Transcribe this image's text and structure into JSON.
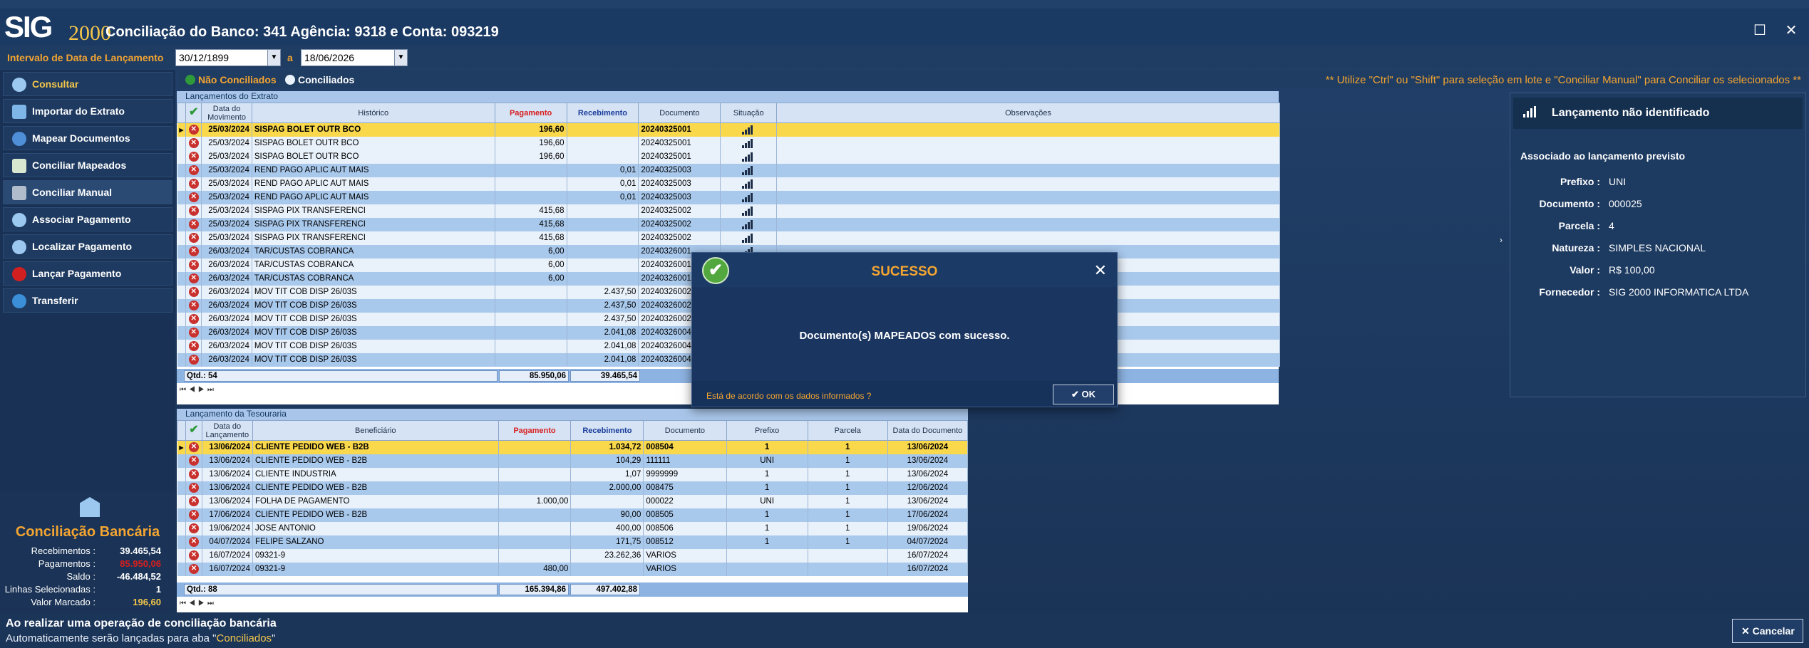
{
  "app": {
    "logo_main": "SIG",
    "logo_sub": "2000",
    "title": "Conciliação do Banco: 341 Agência: 9318 e Conta: 093219"
  },
  "filter": {
    "label": "Intervalo de Data de Lançamento",
    "from": "30/12/1899",
    "sep": "a",
    "to": "18/06/2026"
  },
  "sidebar": {
    "items": [
      {
        "label": "Consultar",
        "icon": "magnifier-icon"
      },
      {
        "label": "Importar do Extrato",
        "icon": "import-icon"
      },
      {
        "label": "Mapear Documentos",
        "icon": "map-pin-icon"
      },
      {
        "label": "Conciliar Mapeados",
        "icon": "checklist-icon"
      },
      {
        "label": "Conciliar Manual",
        "icon": "manual-icon"
      },
      {
        "label": "Associar Pagamento",
        "icon": "magnifier-icon"
      },
      {
        "label": "Localizar Pagamento",
        "icon": "magnifier-icon"
      },
      {
        "label": "Lançar Pagamento",
        "icon": "red-dot-icon"
      },
      {
        "label": "Transferir",
        "icon": "share-icon"
      }
    ]
  },
  "summary": {
    "title": "Conciliação Bancária",
    "rows": [
      {
        "label": "Recebimentos :",
        "value": "39.465,54",
        "color": "#ffffff"
      },
      {
        "label": "Pagamentos :",
        "value": "85.950,06",
        "color": "#d81f1f"
      },
      {
        "label": "Saldo :",
        "value": "-46.484,52",
        "color": "#ffffff"
      },
      {
        "label": "Linhas Selecionadas :",
        "value": "1",
        "color": "#ffffff"
      },
      {
        "label": "Valor Marcado :",
        "value": "196,60",
        "color": "#f4c64a"
      }
    ]
  },
  "legend": {
    "not_reconciled": "Não Conciliados",
    "reconciled": "Conciliados",
    "hint": "** Utilize \"Ctrl\" ou \"Shift\" para seleção em lote e \"Conciliar Manual\" para Conciliar os selecionados **"
  },
  "extrato": {
    "title": "Lançamentos do Extrato",
    "headers": [
      "Data do Movimento",
      "Histórico",
      "Pagamento",
      "Recebimento",
      "Documento",
      "Situação",
      "Observações"
    ],
    "rows": [
      {
        "date": "25/03/2024",
        "hist": "SISPAG BOLET OUTR BCO",
        "pay": "196,60",
        "rec": "",
        "doc": "20240325001",
        "style": "sel"
      },
      {
        "date": "25/03/2024",
        "hist": "SISPAG BOLET OUTR BCO",
        "pay": "196,60",
        "rec": "",
        "doc": "20240325001",
        "style": "even"
      },
      {
        "date": "25/03/2024",
        "hist": "SISPAG BOLET OUTR BCO",
        "pay": "196,60",
        "rec": "",
        "doc": "20240325001",
        "style": "even"
      },
      {
        "date": "25/03/2024",
        "hist": "REND PAGO APLIC AUT MAIS",
        "pay": "",
        "rec": "0,01",
        "doc": "20240325003",
        "style": "alt"
      },
      {
        "date": "25/03/2024",
        "hist": "REND PAGO APLIC AUT MAIS",
        "pay": "",
        "rec": "0,01",
        "doc": "20240325003",
        "style": "even"
      },
      {
        "date": "25/03/2024",
        "hist": "REND PAGO APLIC AUT MAIS",
        "pay": "",
        "rec": "0,01",
        "doc": "20240325003",
        "style": "alt"
      },
      {
        "date": "25/03/2024",
        "hist": "SISPAG PIX TRANSFERENCI",
        "pay": "415,68",
        "rec": "",
        "doc": "20240325002",
        "style": "even"
      },
      {
        "date": "25/03/2024",
        "hist": "SISPAG PIX TRANSFERENCI",
        "pay": "415,68",
        "rec": "",
        "doc": "20240325002",
        "style": "alt"
      },
      {
        "date": "25/03/2024",
        "hist": "SISPAG PIX TRANSFERENCI",
        "pay": "415,68",
        "rec": "",
        "doc": "20240325002",
        "style": "even"
      },
      {
        "date": "26/03/2024",
        "hist": "TAR/CUSTAS COBRANCA",
        "pay": "6,00",
        "rec": "",
        "doc": "20240326001",
        "style": "alt"
      },
      {
        "date": "26/03/2024",
        "hist": "TAR/CUSTAS COBRANCA",
        "pay": "6,00",
        "rec": "",
        "doc": "20240326001",
        "style": "even"
      },
      {
        "date": "26/03/2024",
        "hist": "TAR/CUSTAS COBRANCA",
        "pay": "6,00",
        "rec": "",
        "doc": "20240326001",
        "style": "alt"
      },
      {
        "date": "26/03/2024",
        "hist": "MOV TIT COB DISP 26/03S",
        "pay": "",
        "rec": "2.437,50",
        "doc": "20240326002",
        "style": "even"
      },
      {
        "date": "26/03/2024",
        "hist": "MOV TIT COB DISP 26/03S",
        "pay": "",
        "rec": "2.437,50",
        "doc": "20240326002",
        "style": "alt"
      },
      {
        "date": "26/03/2024",
        "hist": "MOV TIT COB DISP 26/03S",
        "pay": "",
        "rec": "2.437,50",
        "doc": "20240326002",
        "style": "even"
      },
      {
        "date": "26/03/2024",
        "hist": "MOV TIT COB DISP 26/03S",
        "pay": "",
        "rec": "2.041,08",
        "doc": "20240326004",
        "style": "alt"
      },
      {
        "date": "26/03/2024",
        "hist": "MOV TIT COB DISP 26/03S",
        "pay": "",
        "rec": "2.041,08",
        "doc": "20240326004",
        "style": "even"
      },
      {
        "date": "26/03/2024",
        "hist": "MOV TIT COB DISP 26/03S",
        "pay": "",
        "rec": "2.041,08",
        "doc": "20240326004",
        "style": "alt"
      }
    ],
    "total_qtd": "Qtd.: 54",
    "total_pay": "85.950,06",
    "total_rec": "39.465,54"
  },
  "tesouraria": {
    "title": "Lançamento da Tesouraria",
    "headers": [
      "Data do Lançamento",
      "Beneficiário",
      "Pagamento",
      "Recebimento",
      "Documento",
      "Prefixo",
      "Parcela",
      "Data do Documento"
    ],
    "rows": [
      {
        "date": "13/06/2024",
        "benef": "CLIENTE PEDIDO WEB - B2B",
        "pay": "",
        "rec": "1.034,72",
        "doc": "008504",
        "pref": "1",
        "parc": "1",
        "ddoc": "13/06/2024",
        "style": "sel"
      },
      {
        "date": "13/06/2024",
        "benef": "CLIENTE PEDIDO WEB - B2B",
        "pay": "",
        "rec": "104,29",
        "doc": "111111",
        "pref": "UNI",
        "parc": "1",
        "ddoc": "13/06/2024",
        "style": "alt"
      },
      {
        "date": "13/06/2024",
        "benef": "CLIENTE INDUSTRIA",
        "pay": "",
        "rec": "1,07",
        "doc": "9999999",
        "pref": "1",
        "parc": "1",
        "ddoc": "13/06/2024",
        "style": "even"
      },
      {
        "date": "13/06/2024",
        "benef": "CLIENTE PEDIDO WEB - B2B",
        "pay": "",
        "rec": "2.000,00",
        "doc": "008475",
        "pref": "1",
        "parc": "1",
        "ddoc": "12/06/2024",
        "style": "alt"
      },
      {
        "date": "13/06/2024",
        "benef": "FOLHA DE PAGAMENTO",
        "pay": "1.000,00",
        "rec": "",
        "doc": "000022",
        "pref": "UNI",
        "parc": "1",
        "ddoc": "13/06/2024",
        "style": "even"
      },
      {
        "date": "17/06/2024",
        "benef": "CLIENTE PEDIDO WEB - B2B",
        "pay": "",
        "rec": "90,00",
        "doc": "008505",
        "pref": "1",
        "parc": "1",
        "ddoc": "17/06/2024",
        "style": "alt"
      },
      {
        "date": "19/06/2024",
        "benef": "JOSE ANTONIO",
        "pay": "",
        "rec": "400,00",
        "doc": "008506",
        "pref": "1",
        "parc": "1",
        "ddoc": "19/06/2024",
        "style": "even"
      },
      {
        "date": "04/07/2024",
        "benef": "FELIPE SALZANO",
        "pay": "",
        "rec": "171,75",
        "doc": "008512",
        "pref": "1",
        "parc": "1",
        "ddoc": "04/07/2024",
        "style": "alt"
      },
      {
        "date": "16/07/2024",
        "benef": "09321-9",
        "pay": "",
        "rec": "23.262,36",
        "doc": "VARIOS",
        "pref": "",
        "parc": "",
        "ddoc": "16/07/2024",
        "style": "even"
      },
      {
        "date": "16/07/2024",
        "benef": "09321-9",
        "pay": "480,00",
        "rec": "",
        "doc": "VARIOS",
        "pref": "",
        "parc": "",
        "ddoc": "16/07/2024",
        "style": "alt"
      }
    ],
    "total_qtd": "Qtd.: 88",
    "total_pay": "165.394,86",
    "total_rec": "497.402,88"
  },
  "info": {
    "head": "Lançamento não identificado",
    "sub": "Associado ao lançamento previsto",
    "rows": [
      {
        "label": "Prefixo :",
        "value": "UNI"
      },
      {
        "label": "Documento :",
        "value": "000025"
      },
      {
        "label": "Parcela :",
        "value": "4"
      },
      {
        "label": "Natureza :",
        "value": "SIMPLES NACIONAL"
      },
      {
        "label": "Valor :",
        "value": "R$ 100,00"
      },
      {
        "label": "Fornecedor :",
        "value": "SIG 2000 INFORMATICA LTDA"
      }
    ]
  },
  "modal": {
    "title": "SUCESSO",
    "message": "Documento(s) MAPEADOS com sucesso.",
    "question": "Está de acordo com os dados informados ?",
    "ok": "OK"
  },
  "status": {
    "title": "Ao realizar uma operação de conciliação bancária",
    "sub_prefix": "Automaticamente serão lançadas para aba \"",
    "sub_highlight": "Conciliados",
    "sub_suffix": "\"",
    "cancel": "Cancelar"
  },
  "colors": {
    "accent": "#f4a531",
    "selected_row": "#fad84c",
    "not_reconciled_dot": "#2f9a3a",
    "reconciled_dot": "#e9f1fa",
    "negative": "#d81f1f"
  }
}
